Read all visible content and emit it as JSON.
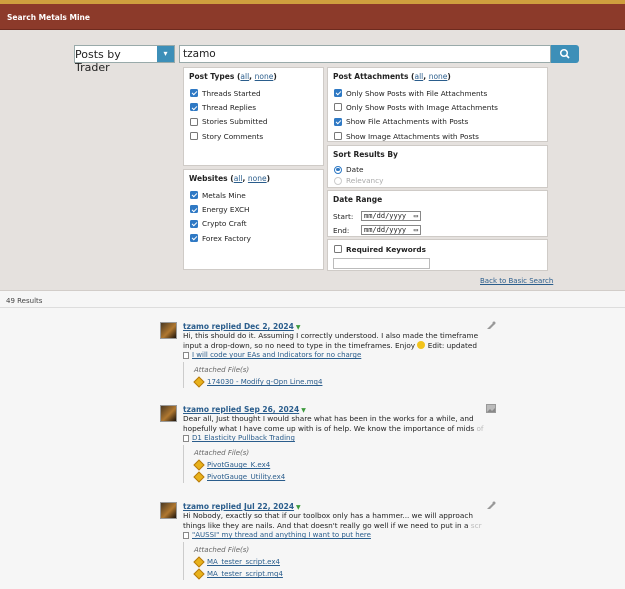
{
  "title": "Search Metals Mine",
  "search": {
    "type_value": "Posts by Trader",
    "query": "tzamo"
  },
  "post_types": {
    "heading": "Post Types",
    "all": "all",
    "none": "none",
    "items": [
      {
        "label": "Threads Started",
        "checked": true
      },
      {
        "label": "Thread Replies",
        "checked": true
      },
      {
        "label": "Stories Submitted",
        "checked": false
      },
      {
        "label": "Story Comments",
        "checked": false
      }
    ]
  },
  "post_attachments": {
    "heading": "Post Attachments",
    "all": "all",
    "none": "none",
    "items": [
      {
        "label": "Only Show Posts with File Attachments",
        "checked": true
      },
      {
        "label": "Only Show Posts with Image Attachments",
        "checked": false
      },
      {
        "label": "Show File Attachments with Posts",
        "checked": true
      },
      {
        "label": "Show Image Attachments with Posts",
        "checked": false
      }
    ]
  },
  "websites": {
    "heading": "Websites",
    "all": "all",
    "none": "none",
    "items": [
      {
        "label": "Metals Mine",
        "checked": true
      },
      {
        "label": "Energy EXCH",
        "checked": true
      },
      {
        "label": "Crypto Craft",
        "checked": true
      },
      {
        "label": "Forex Factory",
        "checked": true
      }
    ]
  },
  "sort": {
    "heading": "Sort Results By",
    "options": [
      {
        "label": "Date",
        "selected": true
      },
      {
        "label": "Relevancy",
        "selected": false
      }
    ]
  },
  "date_range": {
    "heading": "Date Range",
    "start_label": "Start:",
    "end_label": "End:",
    "placeholder": "mm/dd/yyyy"
  },
  "keywords": {
    "label": "Required Keywords",
    "checked": false
  },
  "back_link": "Back to Basic Search",
  "results_count": "49 Results",
  "posts": [
    {
      "title": "tzamo replied Dec 2, 2024",
      "text1": "Hi, this should do it. Assuming I correctly understood. I also made the timeframe",
      "text2a": "input a drop-down, so no need to type in the timeframes. Enjoy ",
      "text2b": " Edit: updated",
      "thread": "I will code your EAs and Indicators for no charge",
      "attached_label": "Attached File(s)",
      "files": [
        "174030 - Modify g-Opn Line.mq4"
      ]
    },
    {
      "title": "tzamo replied Sep 26, 2024",
      "text1": "Dear all, Just thought I would share what has been in the works for a while, and",
      "text2a": "hopefully what I have come up with is of help. We know the importance of mids ",
      "text2b": "of",
      "thread": "D1 Elasticity Pullback Trading",
      "attached_label": "Attached File(s)",
      "files": [
        "PivotGauge_K.ex4",
        "PivotGauge_Utility.ex4"
      ]
    },
    {
      "title": "tzamo replied Jul 22, 2024",
      "text1": "Hi Nobody, exactly so that if our toolbox only has a hammer... we will approach",
      "text2a": "things like they are nails. And that doesn't really go well if we need to put in a ",
      "text2b": "scr",
      "thread": "\"AUSSI\" my thread and anything I want to put here",
      "attached_label": "Attached File(s)",
      "files": [
        "MA_tester_script.ex4",
        "MA_tester_script.mq4"
      ]
    }
  ]
}
